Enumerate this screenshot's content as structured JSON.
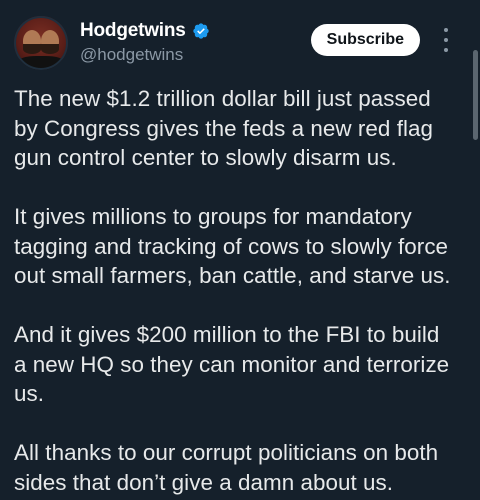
{
  "author": {
    "display_name": "Hodgetwins",
    "handle": "@hodgetwins",
    "verified_icon": "verified-badge-icon",
    "verified_color": "#1d9bf0"
  },
  "actions": {
    "subscribe_label": "Subscribe",
    "more_icon": "more-vertical-icon"
  },
  "tweet": {
    "paragraphs": [
      "The new $1.2 trillion dollar bill just passed by Congress gives the feds a new red flag gun control center to slowly disarm us.",
      "It gives millions to groups for mandatory tagging and tracking of cows to slowly force out small farmers, ban cattle, and starve us.",
      "And it gives $200 million to the FBI to build a new HQ so they can monitor and terrorize us.",
      "All thanks to our corrupt politicians on both sides that don’t give a damn about us."
    ]
  },
  "colors": {
    "background": "#15202b",
    "text": "#e7e9ea",
    "secondary_text": "#8b98a5",
    "button_bg": "#ffffff",
    "button_text": "#0f1419"
  }
}
